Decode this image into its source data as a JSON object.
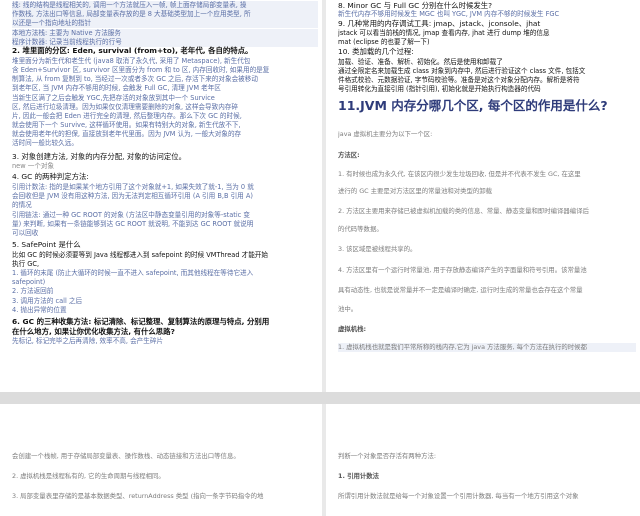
{
  "top_left": [
    "线: 线的结构是线程相关的, 调用一个方法就压入一帧, 帧上面存储局部变量表, 操",
    "作数栈, 方法出口等信息, 局部变量表存放的是 8 大基础类型加上一个应用类型, 所",
    "以还是一个指向地址的指针",
    "本地方法栈: 主要为 Native 方法服务",
    "程序计数器: 记录当前线程执行的行号",
    "2.   堆里面的分区: Eden, survival (from+to), 老年代, 各自的特点。",
    "堆里面分为新生代和老生代 (java8 取消了永久代, 采用了 Metaspace), 新生代包",
    "含 Eden+Survivor 区, survivor 区里面分为 from 和 to 区, 内存回收时, 如果用的是复",
    "制算法, 从 from 复制到 to, 当经过一次或者多次 GC 之后, 存活下来的对象会被移动",
    "到老年区, 当 JVM 内存不够用的时候, 会触发 Full GC, 清理 JVM 老年区",
    "当新生区满了之后会触发 YGC,先把存活的对象放到其中一个 Survice",
    "区, 然后进行垃圾清理。因为如果仅仅清理需要删除的对象, 这样会导致内存碎",
    "片, 因此一般会把 Eden 进行完全的清理, 然后整理内存。那么下次 GC 的时候,",
    "就会使用下一个 Survive, 这样循环使用。如果有特别大的对象, 新生代放不下,",
    "就会使用老年代的担保, 直接放到老年代里面。因为 JVM 认为, 一般大对象的存",
    "活时间一般比较久远。",
    "3.  对象创建方法, 对象的内存分配, 对象的访问定位。",
    "new 一个对象",
    "4.   GC 的两种判定方法:",
    "引用计数法: 指的是如果某个地方引用了这个对象就+1, 如果失效了就-1, 当为 0 就",
    "会回收但是 JVM 没有用这种方法, 因为无法判定相互循环引用 (A 引用 B,B 引用 A)",
    "的情况",
    "引用链法:   通过一种 GC ROOT 的对象 (方法区中静态变量引用的对象等-static 变",
    "量) 来判断, 如果有一条链能够到达 GC ROOT 就说明, 不能到达 GC ROOT 就说明",
    "可以回收",
    "5.   SafePoint 是什么",
    "比如 GC 的时候必须要等到 Java 线程都进入到 safepoint 的时候 VMThread 才能开始",
    "执行 GC,",
    "1.  循环的末尾 (防止大循环的时候一直不进入 safepoint, 而其他线程在等待它进入",
    "safepoint)",
    "2.  方法返回前",
    "3.  调用方法的 call 之后",
    "4.  抛出异常的位置",
    "6. GC 的三种收集方法: 标记清除、标记整理、复制算法的原理与特点, 分别用",
    "在什么地方, 如果让你优化收集方法, 有什么思路?",
    "先标记, 标记完毕之后再清除, 效率不高, 会产生碎片"
  ],
  "top_right": [
    "8.   Minor GC 与 Full GC 分别在什么时候发生?",
    "新生代内存不够用时候发生 MGC 也叫 YGC, JVM 内存不够的时候发生 FGC",
    "9.   几种常用的内存调试工具: jmap、jstack、jconsole、jhat",
    "jstack 可以看当前栈的情况, jmap 查看内存, jhat 进行 dump 堆的信息",
    "mat (eclipse 的也要了解一下)",
    "10. 类加载的几个过程:",
    "加载、验证、准备、解析、初始化。然后是使用和卸载了",
    "通过全限定名来加载生成 class 对象到内存中, 然后进行验证这个 class 文件, 包括文",
    "件格式校验、元数据验证, 字节码校验等。准备是对这个对象分配内存。解析是将符",
    "号引用转化为直接引用 (指针引用), 初始化就是开始执行构造器的代码",
    "11.JVM 内存分哪几个区, 每个区的作用是什么?",
    "java 虚拟机主要分为以下一个区:",
    "方法区:",
    "1. 有时候也成为永久代, 在该区内很少发生垃圾回收, 但是并不代表不发生 GC, 在这里",
    "进行的 GC 主要是对方法区里的常量池和对类型的卸载",
    "2. 方法区主要用来存储已被虚拟机加载的类的信息、常量、静态变量和即时编译器编译后",
    "的代码等数据。",
    "3. 该区域是被线程共享的。",
    "4. 方法区里有一个运行时常量池, 用于存放静态编译产生的字面量和符号引用。该常量池",
    "具有动态性, 也就是说常量并不一定是编译时确定, 运行时生成的常量也会存在这个常量",
    "池中。",
    "虚拟机栈:",
    "1. 虚拟机栈也就是我们平常所称的栈内存,它为 java 方法服务, 每个方法在执行的时候都"
  ],
  "bottom_left": [
    "会创建一个栈帧, 用于存储局部变量表、操作数栈、动态链接和方法出口等信息。",
    "2. 虚拟机栈是线程私有的, 它的生命周期与线程相同。",
    "3. 局部变量表里存储的是基本数据类型、returnAddress 类型 (指向一条字节码指令的地"
  ],
  "bottom_right": [
    "判断一个对象是否存活有两种方法:",
    "1. 引用计数法",
    "所谓引用计数法就是给每一个对象设置一个引用计数器, 每当有一个地方引用这个对象"
  ]
}
